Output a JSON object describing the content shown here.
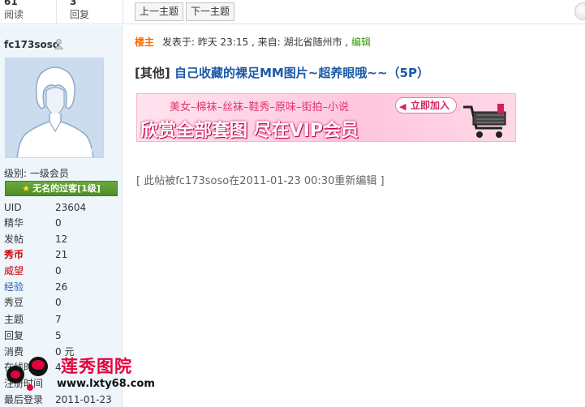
{
  "topbar": {
    "stats": [
      {
        "num": "61",
        "label": "阅读"
      },
      {
        "num": "3",
        "label": "回复"
      }
    ],
    "prev_topic": "上一主题",
    "next_topic": "下一主题"
  },
  "user": {
    "name": "fc173soso",
    "avatar_watermark": "pw",
    "level": "级别: 一级会员",
    "rank": "无名的过客[1级]",
    "info": [
      {
        "key": "UID",
        "value": "23604"
      },
      {
        "key": "精华",
        "value": "0"
      },
      {
        "key": "发帖",
        "value": "12"
      },
      {
        "key": "秀币",
        "value": "21"
      },
      {
        "key": "威望",
        "value": "0"
      },
      {
        "key": "经验",
        "value": "26"
      },
      {
        "key": "秀豆",
        "value": "0"
      },
      {
        "key": "主题",
        "value": "7"
      },
      {
        "key": "回复",
        "value": "5"
      },
      {
        "key": "消费",
        "value": "0 元"
      },
      {
        "key": "在线时间",
        "value": "4"
      },
      {
        "key": "注册时间",
        "value": ""
      },
      {
        "key": "最后登录",
        "value": "2011-01-23"
      }
    ]
  },
  "post": {
    "floor": "楼主",
    "posted_label": "发表于: 昨天",
    "posted_time": "23:15",
    "source": ", 来自: 湖北省随州市",
    "edit_label": "编辑",
    "category": "[其他]",
    "title": "自己收藏的裸足MM图片~超养眼哦~~（5P）",
    "banner_top": "美女–棉袜–丝袜–鞋秀–原味–街拍–小说",
    "banner_main": "欣赏全部套图 尽在VIP会员",
    "banner_join": "立即加入",
    "edit_note": "[ 此帖被fc173soso在2011-01-23 00:30重新编辑 ]"
  },
  "watermark": {
    "site_name": "莲秀图院",
    "url": "www.lxty68.com"
  },
  "colors": {
    "panel_bg": "#eef5fb",
    "rank_green": "#5a9a2e",
    "title_blue": "#1a5aa8",
    "floor_orange": "#ff6600",
    "banner_pink": "#ffc6dd"
  }
}
